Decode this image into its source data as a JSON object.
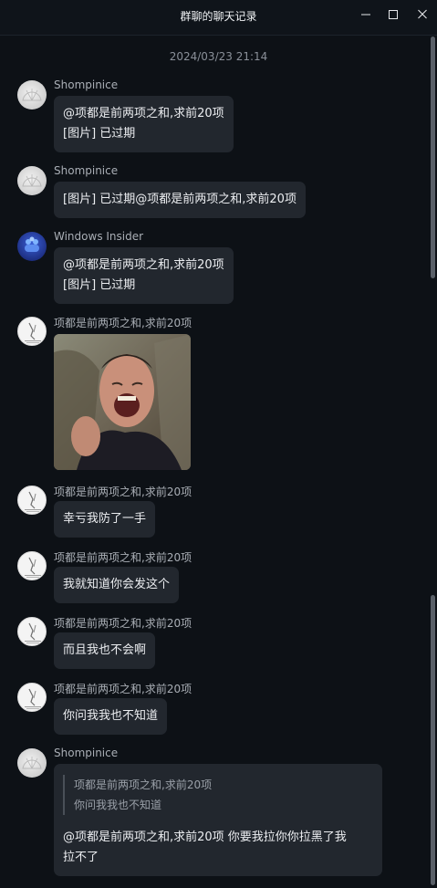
{
  "window": {
    "title": "群聊的聊天记录",
    "minimize_icon": "minimize-icon",
    "maximize_icon": "maximize-icon",
    "close_icon": "close-icon"
  },
  "timestamp": "2024/03/23 21:14",
  "messages": [
    {
      "sender": "Shompinice",
      "avatar": "shell-avatar",
      "lines": [
        "@项都是前两项之和,求前20项",
        "[图片] 已过期"
      ]
    },
    {
      "sender": "Shompinice",
      "avatar": "shell-avatar",
      "lines": [
        "[图片] 已过期@项都是前两项之和,求前20项"
      ]
    },
    {
      "sender": "Windows Insider",
      "avatar": "windows-insider-avatar",
      "lines": [
        "@项都是前两项之和,求前20项",
        "[图片] 已过期"
      ]
    },
    {
      "sender": "项都是前两项之和,求前20项",
      "avatar": "note-avatar",
      "image": "laughing-man-photo"
    },
    {
      "sender": "项都是前两项之和,求前20项",
      "avatar": "note-avatar",
      "lines": [
        "幸亏我防了一手"
      ]
    },
    {
      "sender": "项都是前两项之和,求前20项",
      "avatar": "note-avatar",
      "lines": [
        "我就知道你会发这个"
      ]
    },
    {
      "sender": "项都是前两项之和,求前20项",
      "avatar": "note-avatar",
      "lines": [
        "而且我也不会啊"
      ]
    },
    {
      "sender": "项都是前两项之和,求前20项",
      "avatar": "note-avatar",
      "lines": [
        "你问我我也不知道"
      ]
    },
    {
      "sender": "Shompinice",
      "avatar": "shell-avatar",
      "quote": {
        "author": "项都是前两项之和,求前20项",
        "text": "你问我我也不知道"
      },
      "lines": [
        "@项都是前两项之和,求前20项 你要我拉你你拉黑了我",
        "拉不了"
      ]
    }
  ],
  "colors": {
    "background": "#0d1116",
    "bubble": "#22272e",
    "text": "#eceef1",
    "muted": "#a9aeb5"
  }
}
